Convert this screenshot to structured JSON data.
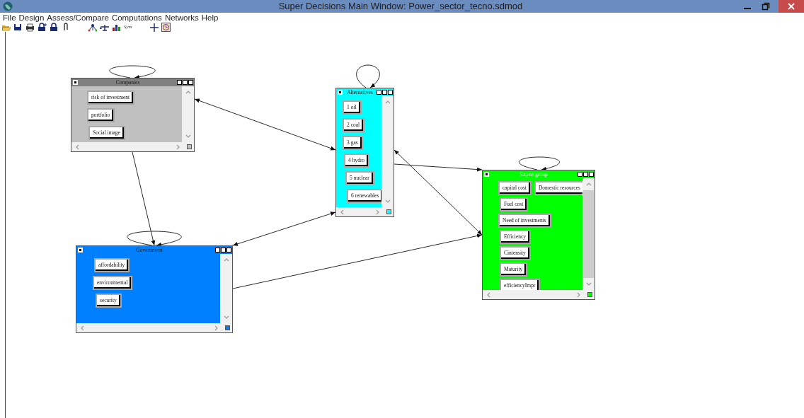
{
  "window": {
    "title": "Super Decisions Main Window: Power_sector_tecno.sdmod"
  },
  "menu": [
    {
      "label": "File"
    },
    {
      "label": "Design"
    },
    {
      "label": "Assess/Compare"
    },
    {
      "label": "Computations"
    },
    {
      "label": "Networks"
    },
    {
      "label": "Help"
    }
  ],
  "toolbar": [
    {
      "kind": "folder"
    },
    {
      "kind": "save"
    },
    {
      "kind": "print"
    },
    {
      "kind": "lockplus"
    },
    {
      "kind": "lock"
    },
    {
      "kind": "clip"
    },
    {
      "kind": "gap"
    },
    {
      "kind": "network"
    },
    {
      "kind": "scale"
    },
    {
      "kind": "bars"
    },
    {
      "kind": "text",
      "label": "Sym"
    },
    {
      "kind": "gap"
    },
    {
      "kind": "cross"
    },
    {
      "kind": "clock"
    }
  ],
  "clusters": [
    {
      "title": "Companies",
      "color": "#c0c0c0",
      "rows": [
        [
          "risk of investment"
        ],
        [
          "portfolio"
        ],
        [
          "Social image"
        ]
      ]
    },
    {
      "title": "Alternatives",
      "color": "#00ffff",
      "rows": [
        [
          "1 oil"
        ],
        [
          "2 coal"
        ],
        [
          "3 gas"
        ],
        [
          "4 hydro"
        ],
        [
          "5 nuclear"
        ],
        [
          "6 renewables"
        ]
      ]
    },
    {
      "title": "Expert group",
      "color": "#00ff00",
      "rows": [
        [
          "capital cost",
          "Domestic resources"
        ],
        [
          "Fuel cost"
        ],
        [
          "Need of investments"
        ],
        [
          "Efficiency"
        ],
        [
          "Cintensity"
        ],
        [
          "Maturity"
        ],
        [
          "efficiencyImpr"
        ]
      ]
    },
    {
      "title": "Government",
      "color": "#0080ff",
      "rows": [
        [
          "affordability"
        ],
        [
          "environmental"
        ],
        [
          "security"
        ]
      ]
    }
  ]
}
